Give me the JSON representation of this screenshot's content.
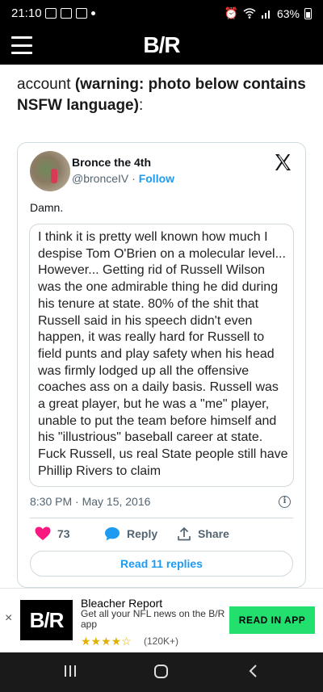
{
  "status_bar": {
    "time": "21:10",
    "battery": "63%"
  },
  "app_header": {
    "logo": "B/R"
  },
  "article": {
    "line1": "account ",
    "bold": "(warning: photo below contains NSFW language)",
    "tail": ":"
  },
  "tweet": {
    "author_name": "Bronce the 4th",
    "handle": "@bronceIV",
    "separator": " · ",
    "follow": "Follow",
    "text": "Damn.",
    "image_quote": "I think it is pretty well known how much I despise Tom O'Brien on a molecular level... However... Getting rid of Russell Wilson was the one admirable thing he did during his tenure at state. 80% of the shit that Russell said in his speech didn't even happen, it was really hard for Russell to field punts and play safety when his head was firmly lodged up all the offensive coaches ass on a daily basis. Russell was a great player, but he was a \"me\" player, unable to put the team before himself and his \"illustrious\" baseball career at state. Fuck Russell, us real State people still have Phillip Rivers to claim",
    "timestamp": "8:30 PM · May 15, 2016",
    "likes": "73",
    "reply_label": "Reply",
    "share_label": "Share",
    "read_replies": "Read 11 replies",
    "colors": {
      "accent": "#1d9bf0",
      "heart": "#f91880"
    }
  },
  "ad": {
    "close": "×",
    "logo": "B/R",
    "title": "Bleacher Report",
    "description": "Get all your NFL news on the B/R app",
    "rating_count": "(120K+)",
    "rating": 4.5,
    "cta": "READ IN APP",
    "cta_color": "#22e06e"
  }
}
